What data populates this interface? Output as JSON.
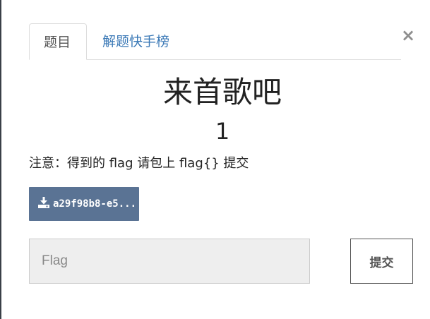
{
  "tabs": [
    {
      "label": "题目",
      "active": true
    },
    {
      "label": "解题快手榜",
      "active": false
    }
  ],
  "close_label": "×",
  "challenge": {
    "title": "来首歌吧",
    "score": "1",
    "note": "注意：得到的 flag 请包上 flag{} 提交"
  },
  "download": {
    "icon": "download-icon",
    "label": "a29f98b8-e5..."
  },
  "flag_form": {
    "placeholder": "Flag",
    "value": "",
    "submit_label": "提交"
  },
  "colors": {
    "download_bg": "#5a7394",
    "link": "#3c7ab7",
    "input_bg": "#eeeeee"
  }
}
